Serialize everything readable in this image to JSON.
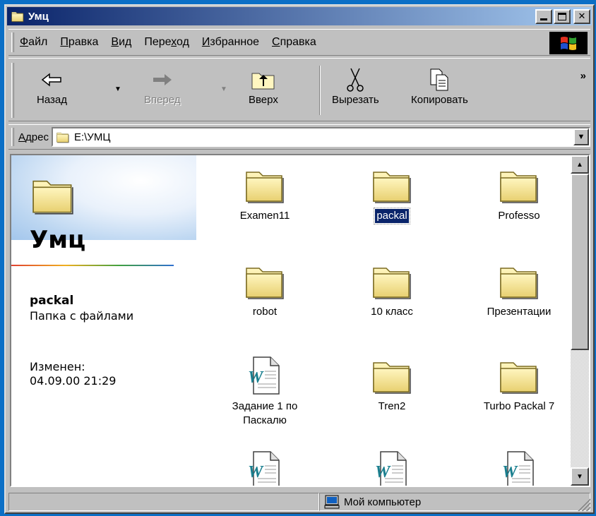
{
  "window": {
    "title": "Умц"
  },
  "menu": {
    "items": [
      {
        "accel": "Ф",
        "rest": "айл"
      },
      {
        "accel": "П",
        "rest": "равка"
      },
      {
        "accel": "В",
        "rest": "ид"
      },
      {
        "pre": "Пере",
        "accel": "х",
        "rest": "од"
      },
      {
        "accel": "И",
        "rest": "збранное"
      },
      {
        "accel": "С",
        "rest": "правка"
      }
    ]
  },
  "toolbar": {
    "back_label": "Назад",
    "forward_label": "Вперед",
    "up_label": "Вверх",
    "cut_label": "Вырезать",
    "copy_label": "Копировать",
    "more": "»"
  },
  "address": {
    "accel": "А",
    "rest": "дрес",
    "value": "E:\\УМЦ"
  },
  "webview": {
    "folder_title": "Умц",
    "selected_name": "packal",
    "selected_type": "Папка с файлами",
    "modified_label": "Изменен:",
    "modified_value": "04.09.00 21:29"
  },
  "files": [
    {
      "label": "Examen11",
      "type": "folder",
      "selected": false
    },
    {
      "label": "packal",
      "type": "folder",
      "selected": true
    },
    {
      "label": "Professo",
      "type": "folder",
      "selected": false
    },
    {
      "label": "robot",
      "type": "folder",
      "selected": false
    },
    {
      "label": "10 класс",
      "type": "folder",
      "selected": false
    },
    {
      "label": "Презентации",
      "type": "folder",
      "selected": false
    },
    {
      "label": "Задание 1 по Паскалю",
      "type": "word",
      "selected": false
    },
    {
      "label": "Tren2",
      "type": "folder",
      "selected": false
    },
    {
      "label": "Turbo Packal 7",
      "type": "folder",
      "selected": false
    },
    {
      "label": "",
      "type": "word",
      "selected": false
    },
    {
      "label": "",
      "type": "word",
      "selected": false
    },
    {
      "label": "",
      "type": "word",
      "selected": false
    }
  ],
  "status": {
    "zone": "Мой компьютер"
  }
}
